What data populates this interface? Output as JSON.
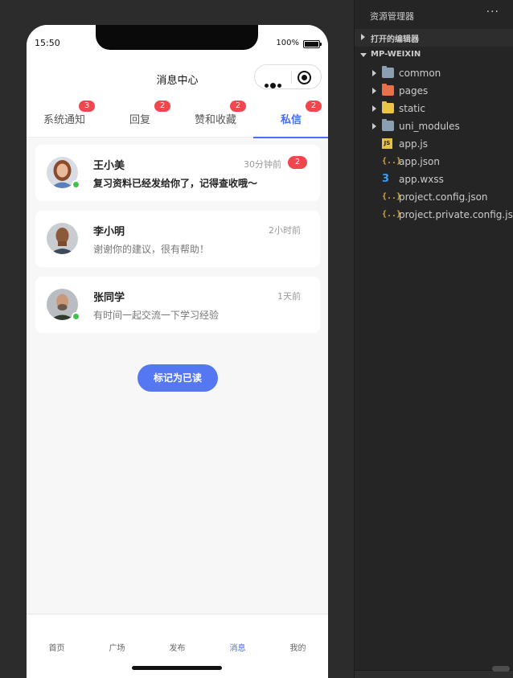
{
  "status_bar": {
    "time": "15:50",
    "battery_text": "100%"
  },
  "nav": {
    "title": "消息中心"
  },
  "tabs": [
    {
      "label": "系统通知",
      "badge": "3",
      "active": false
    },
    {
      "label": "回复",
      "badge": "2",
      "active": false
    },
    {
      "label": "赞和收藏",
      "badge": "2",
      "active": false
    },
    {
      "label": "私信",
      "badge": "2",
      "active": true
    }
  ],
  "messages": [
    {
      "name": "王小美",
      "time": "30分钟前",
      "badge": "2",
      "text": "复习资料已经发给你了，记得查收哦～",
      "online": true,
      "unread": true
    },
    {
      "name": "李小明",
      "time": "2小时前",
      "badge": "",
      "text": "谢谢你的建议，很有帮助！",
      "online": false,
      "unread": false
    },
    {
      "name": "张同学",
      "time": "1天前",
      "badge": "",
      "text": "有时间一起交流一下学习经验",
      "online": true,
      "unread": false
    }
  ],
  "actions": {
    "mark_read": "标记为已读"
  },
  "tabbar": [
    {
      "label": "首页",
      "active": false
    },
    {
      "label": "广场",
      "active": false
    },
    {
      "label": "发布",
      "active": false
    },
    {
      "label": "消息",
      "active": true
    },
    {
      "label": "我的",
      "active": false
    }
  ],
  "explorer": {
    "title": "资源管理器",
    "more": "···",
    "open_editors": "打开的编辑器",
    "project": "MP-WEIXIN",
    "items": [
      {
        "label": "common",
        "type": "folder",
        "icon": "folder-icon",
        "color": "#8aa0b2"
      },
      {
        "label": "pages",
        "type": "folder",
        "icon": "pages-folder-icon",
        "color": "#e8704a"
      },
      {
        "label": "static",
        "type": "folder",
        "icon": "static-folder-icon",
        "color": "#e9c34a"
      },
      {
        "label": "uni_modules",
        "type": "folder",
        "icon": "folder-icon",
        "color": "#8aa0b2"
      },
      {
        "label": "app.js",
        "type": "js",
        "icon": "js-file-icon",
        "badge": "JS"
      },
      {
        "label": "app.json",
        "type": "json",
        "icon": "json-file-icon",
        "badge": "{..}"
      },
      {
        "label": "app.wxss",
        "type": "css",
        "icon": "css-file-icon",
        "badge": "3"
      },
      {
        "label": "project.config.json",
        "type": "json",
        "icon": "json-file-icon",
        "badge": "{..}"
      },
      {
        "label": "project.private.config.js...",
        "type": "json",
        "icon": "json-file-icon",
        "badge": "{..}"
      }
    ]
  },
  "colors": {
    "accent": "#4a6cf7",
    "badge": "#f0464e",
    "online": "#3ec44a",
    "button": "#5577f2"
  }
}
